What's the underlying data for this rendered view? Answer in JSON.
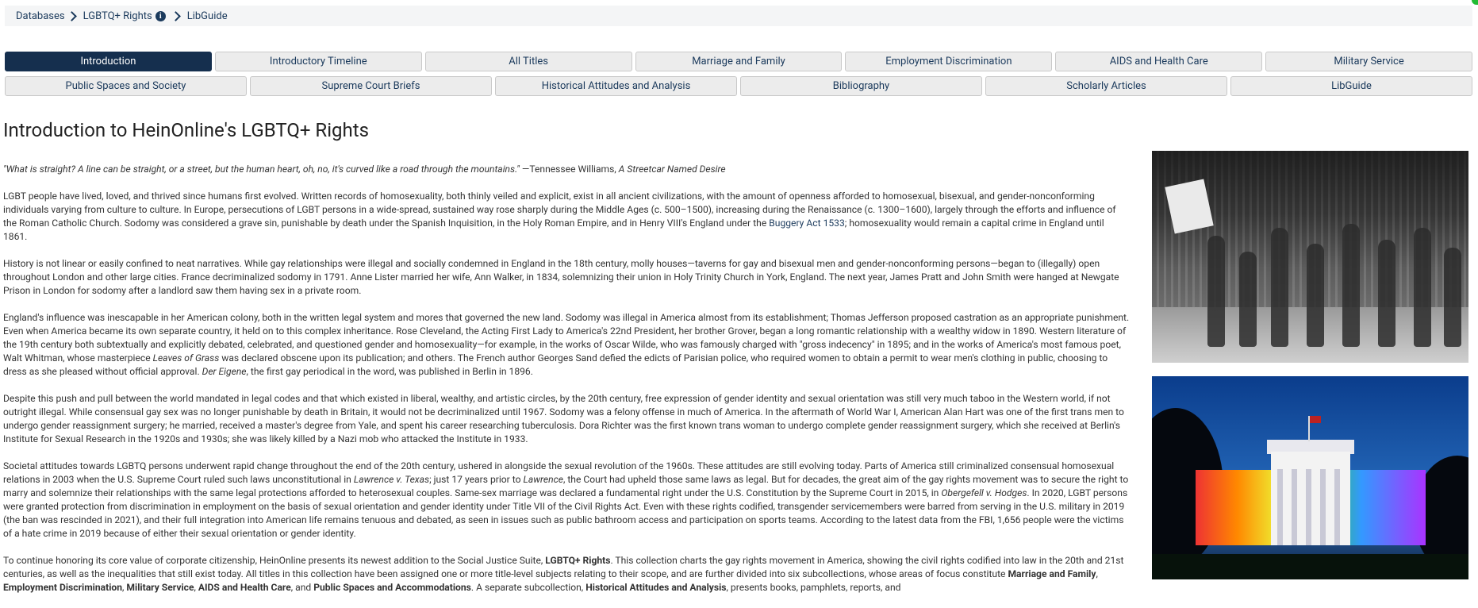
{
  "breadcrumb": {
    "items": [
      "Databases",
      "LGBTQ+ Rights",
      "LibGuide"
    ]
  },
  "tabs": {
    "row1": [
      "Introduction",
      "Introductory Timeline",
      "All Titles",
      "Marriage and Family",
      "Employment Discrimination",
      "AIDS and Health Care",
      "Military Service"
    ],
    "row2": [
      "Public Spaces and Society",
      "Supreme Court Briefs",
      "Historical Attitudes and Analysis",
      "Bibliography",
      "Scholarly Articles",
      "LibGuide"
    ],
    "active": "Introduction"
  },
  "page": {
    "title": "Introduction to HeinOnline's LGBTQ+ Rights"
  },
  "content": {
    "quote": "\"What is straight? A line can be straight, or a street, but the human heart, oh, no, it's curved like a road through the mountains.\"",
    "quote_attr": " —Tennessee Williams, ",
    "quote_source": "A Streetcar Named Desire",
    "p1a": "LGBT people have lived, loved, and thrived since humans first evolved. Written records of homosexuality, both thinly veiled and explicit, exist in all ancient civilizations, with the amount of openness afforded to homosexual, bisexual, and gender-nonconforming individuals varying from culture to culture. In Europe, persecutions of LGBT persons in a wide-spread, sustained way rose sharply during the Middle Ages (c. 500–1500), increasing during the Renaissance (c. 1300–1600), largely through the efforts and influence of the Roman Catholic Church. Sodomy was considered a grave sin, punishable by death under the Spanish Inquisition, in the Holy Roman Empire, and in Henry VIII's England under the ",
    "p1_link": "Buggery Act 1533",
    "p1b": "; homosexuality would remain a capital crime in England until 1861.",
    "p2": "History is not linear or easily confined to neat narratives. While gay relationships were illegal and socially condemned in England in the 18th century, molly houses—taverns for gay and bisexual men and gender-nonconforming persons—began to (illegally) open throughout London and other large cities. France decriminalized sodomy in 1791. Anne Lister married her wife, Ann Walker, in 1834, solemnizing their union in Holy Trinity Church in York, England. The next year, James Pratt and John Smith were hanged at Newgate Prison in London for sodomy after a landlord saw them having sex in a private room.",
    "p3a": "England's influence was inescapable in her American colony, both in the written legal system and mores that governed the new land. Sodomy was illegal in America almost from its establishment; Thomas Jefferson proposed castration as an appropriate punishment. Even when America became its own separate country, it held on to this complex inheritance. Rose Cleveland, the Acting First Lady to America's 22nd President, her brother Grover, began a long romantic relationship with a wealthy widow in 1890. Western literature of the 19th century both subtextually and explicitly debated, celebrated, and questioned gender and homosexuality—for example, in the works of Oscar Wilde, who was famously charged with \"gross indecency\" in 1895; and in the works of America's most famous poet, Walt Whitman, whose masterpiece ",
    "p3_em1": "Leaves of Grass",
    "p3b": " was declared obscene upon its publication; and others. The French author Georges Sand defied the edicts of Parisian police, who required women to obtain a permit to wear men's clothing in public, choosing to dress as she pleased without official approval. ",
    "p3_em2": "Der Eigene",
    "p3c": ", the first gay periodical in the word, was published in Berlin in 1896.",
    "p4": "Despite this push and pull between the world mandated in legal codes and that which existed in liberal, wealthy, and artistic circles, by the 20th century, free expression of gender identity and sexual orientation was still very much taboo in the Western world, if not outright illegal. While consensual gay sex was no longer punishable by death in Britain, it would not be decriminalized until 1967. Sodomy was a felony offense in much of America. In the aftermath of World War I, American Alan Hart was one of the first trans men to undergo gender reassignment surgery; he married, received a master's degree from Yale, and spent his career researching tuberculosis. Dora Richter was the first known trans woman to undergo complete gender reassignment surgery, which she received at Berlin's Institute for Sexual Research in the 1920s and 1930s; she was likely killed by a Nazi mob who attacked the Institute in 1933.",
    "p5a": "Societal attitudes towards LGBTQ persons underwent rapid change throughout the end of the 20th century, ushered in alongside the sexual revolution of the 1960s. These attitudes are still evolving today. Parts of America still criminalized consensual homosexual relations in 2003 when the U.S. Supreme Court ruled such laws unconstitutional in ",
    "p5_em1": "Lawrence v. Texas",
    "p5b": "; just 17 years prior to ",
    "p5_em2": "Lawrence",
    "p5c": ", the Court had upheld those same laws as legal. But for decades, the great aim of the gay rights movement was to secure the right to marry and solemnize their relationships with the same legal protections afforded to heterosexual couples. Same-sex marriage was declared a fundamental right under the U.S. Constitution by the Supreme Court in 2015, in ",
    "p5_em3": "Obergefell v. Hodges",
    "p5d": ". In 2020, LGBT persons were granted protection from discrimination in employment on the basis of sexual orientation and gender identity under Title VII of the Civil Rights Act. Even with these rights codified, transgender servicemembers were barred from serving in the U.S. military in 2019 (the ban was rescinded in 2021), and their full integration into American life remains tenuous and debated, as seen in issues such as public bathroom access and participation on sports teams. According to the latest data from the FBI, 1,656 people were the victims of a hate crime in 2019 because of either their sexual orientation or gender identity.",
    "p6a": "To continue honoring its core value of corporate citizenship, HeinOnline presents its newest addition to the Social Justice Suite, ",
    "p6_b1": "LGBTQ+ Rights",
    "p6b": ". This collection charts the gay rights movement in America, showing the civil rights codified into law in the 20th and 21st centuries, as well as the inequalities that still exist today. All titles in this collection have been assigned one or more title-level subjects relating to their scope, and are further divided into six subcollections, whose areas of focus constitute ",
    "p6_b2": "Marriage and Family",
    "p6_s1": ", ",
    "p6_b3": "Employment Discrimination",
    "p6_s2": ", ",
    "p6_b4": "Military Service",
    "p6_s3": ", ",
    "p6_b5": "AIDS and Health Care",
    "p6_s4": ", and ",
    "p6_b6": "Public Spaces and Accommodations",
    "p6c": ". A separate subcollection, ",
    "p6_b7": "Historical Attitudes and Analysis",
    "p6d": ", presents books, pamphlets, reports, and"
  },
  "icons": {
    "info": "info-icon",
    "chevron": "chevron-right-icon"
  },
  "colors": {
    "nav_active": "#152f4e",
    "link": "#1b3a5c",
    "tab_bg": "#ececec"
  }
}
